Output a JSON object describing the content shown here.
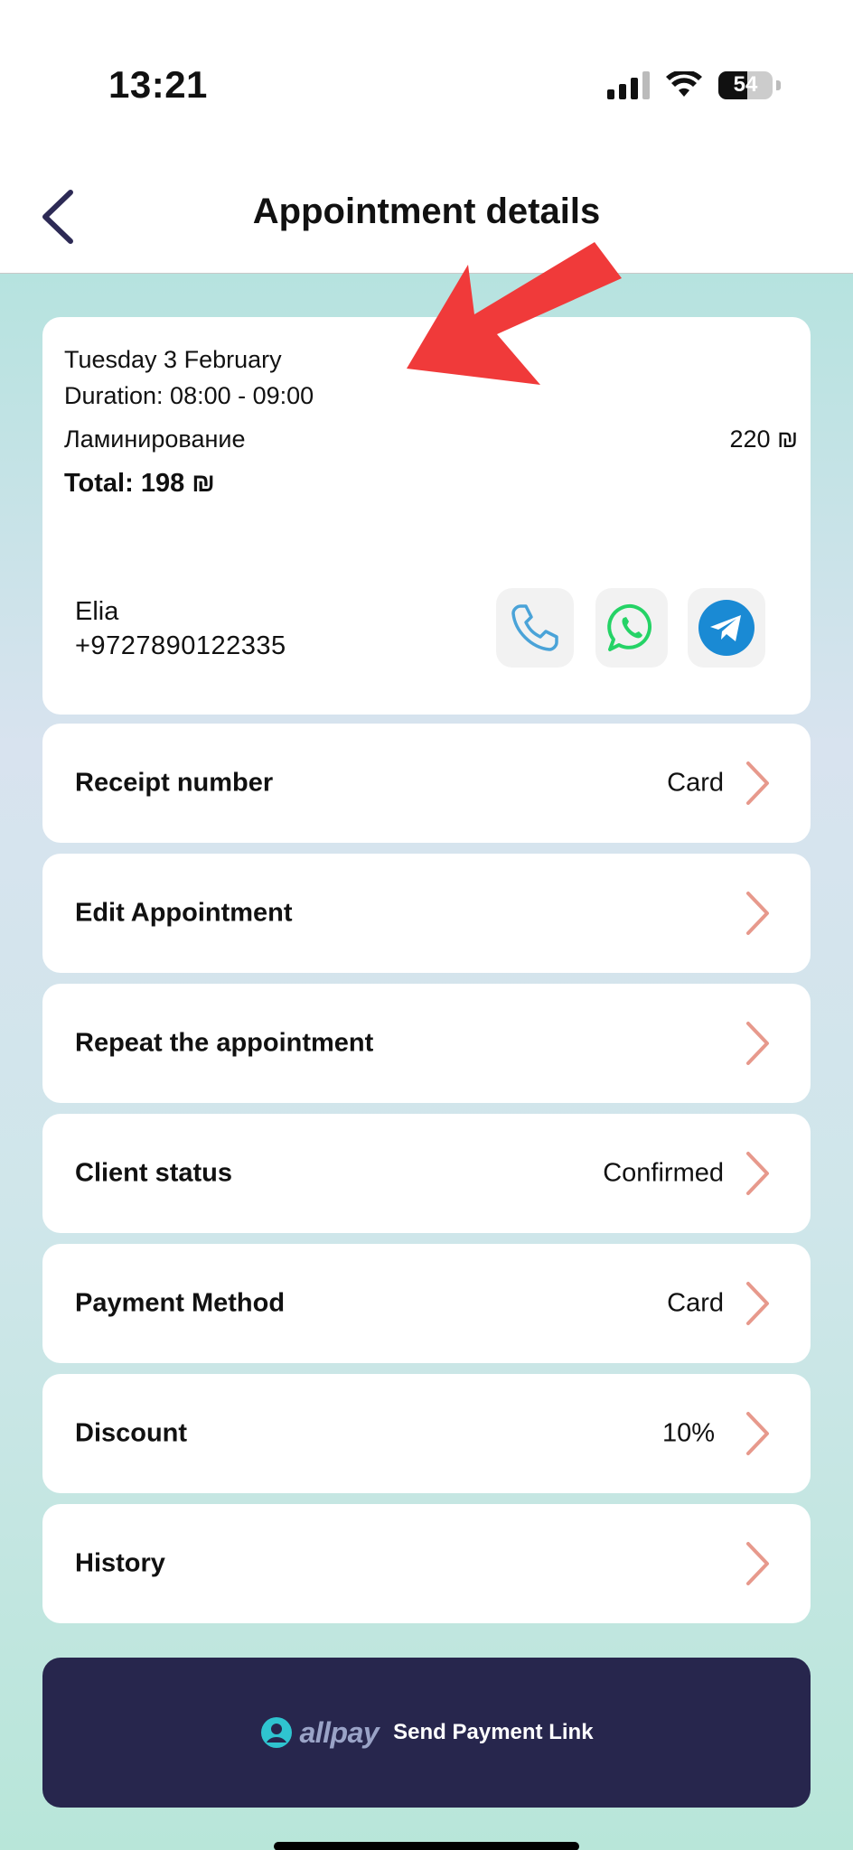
{
  "status_bar": {
    "time": "13:21",
    "battery": "54",
    "battery_level": 0.54
  },
  "header": {
    "title": "Appointment details",
    "back_icon": "chevron-left-icon"
  },
  "summary": {
    "date": "Tuesday 3 February",
    "duration": "Duration: 08:00 - 09:00",
    "service": "Ламинирование",
    "service_price": "220 ₪",
    "total": "Total: 198 ₪",
    "client_name": "Elia",
    "client_phone": "+9727890122335",
    "contacts": [
      {
        "icon": "phone-icon",
        "color": "#4aa3d8"
      },
      {
        "icon": "whatsapp-icon",
        "color": "#25d366"
      },
      {
        "icon": "telegram-icon",
        "color": "#1a8ad4"
      }
    ]
  },
  "rows": [
    {
      "label": "Receipt number",
      "value": "Card"
    },
    {
      "label": "Edit Appointment",
      "value": ""
    },
    {
      "label": "Repeat the appointment",
      "value": ""
    },
    {
      "label": "Client status",
      "value": "Confirmed"
    },
    {
      "label": "Payment Method",
      "value": "Card"
    },
    {
      "label": "Discount",
      "value": "10%"
    },
    {
      "label": "History",
      "value": ""
    }
  ],
  "payment_button": {
    "brand": "allpay",
    "label": "Send Payment Link"
  },
  "colors": {
    "accent_chevron": "#e7998c",
    "button_bg": "#27264d",
    "annotation_arrow": "#f03a3a",
    "back_arrow": "#2d2a55"
  }
}
